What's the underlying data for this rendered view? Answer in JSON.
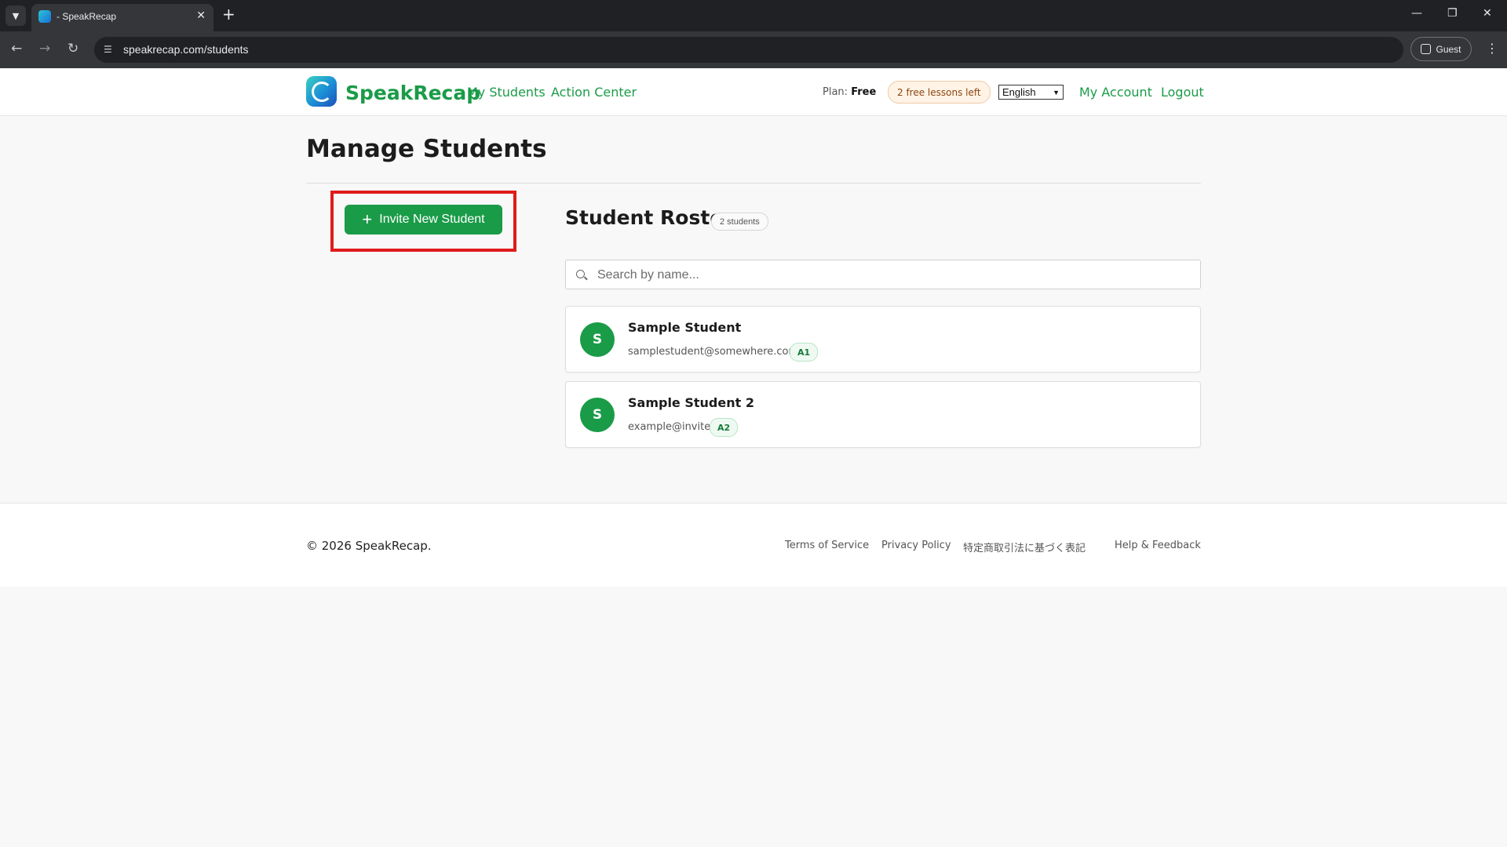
{
  "browser": {
    "tab_title": "- SpeakRecap",
    "url": "speakrecap.com/students",
    "guest_label": "Guest"
  },
  "header": {
    "brand": "SpeakRecap",
    "nav": [
      {
        "label": "My Students"
      },
      {
        "label": "Action Center"
      }
    ],
    "plan_label": "Plan:",
    "plan_value": "Free",
    "lessons_badge": "2 free lessons left",
    "language": "English",
    "account_link": "My Account",
    "logout_link": "Logout"
  },
  "main": {
    "page_title": "Manage Students",
    "invite_button": "Invite New Student",
    "roster_title": "Student Roster",
    "student_count": "2 students",
    "search_placeholder": "Search by name...",
    "students": [
      {
        "initial": "S",
        "name": "Sample Student",
        "email": "samplestudent@somewhere.com",
        "level": "A1"
      },
      {
        "initial": "S",
        "name": "Sample Student 2",
        "email": "example@invite",
        "level": "A2"
      }
    ]
  },
  "footer": {
    "copyright": "© 2026 SpeakRecap.",
    "links": [
      {
        "label": "Terms of Service"
      },
      {
        "label": "Privacy Policy"
      },
      {
        "label": "特定商取引法に基づく表記"
      },
      {
        "label": "Help & Feedback"
      }
    ]
  },
  "colors": {
    "brand_green": "#1a9b48",
    "highlight_red": "#e01b1b"
  }
}
